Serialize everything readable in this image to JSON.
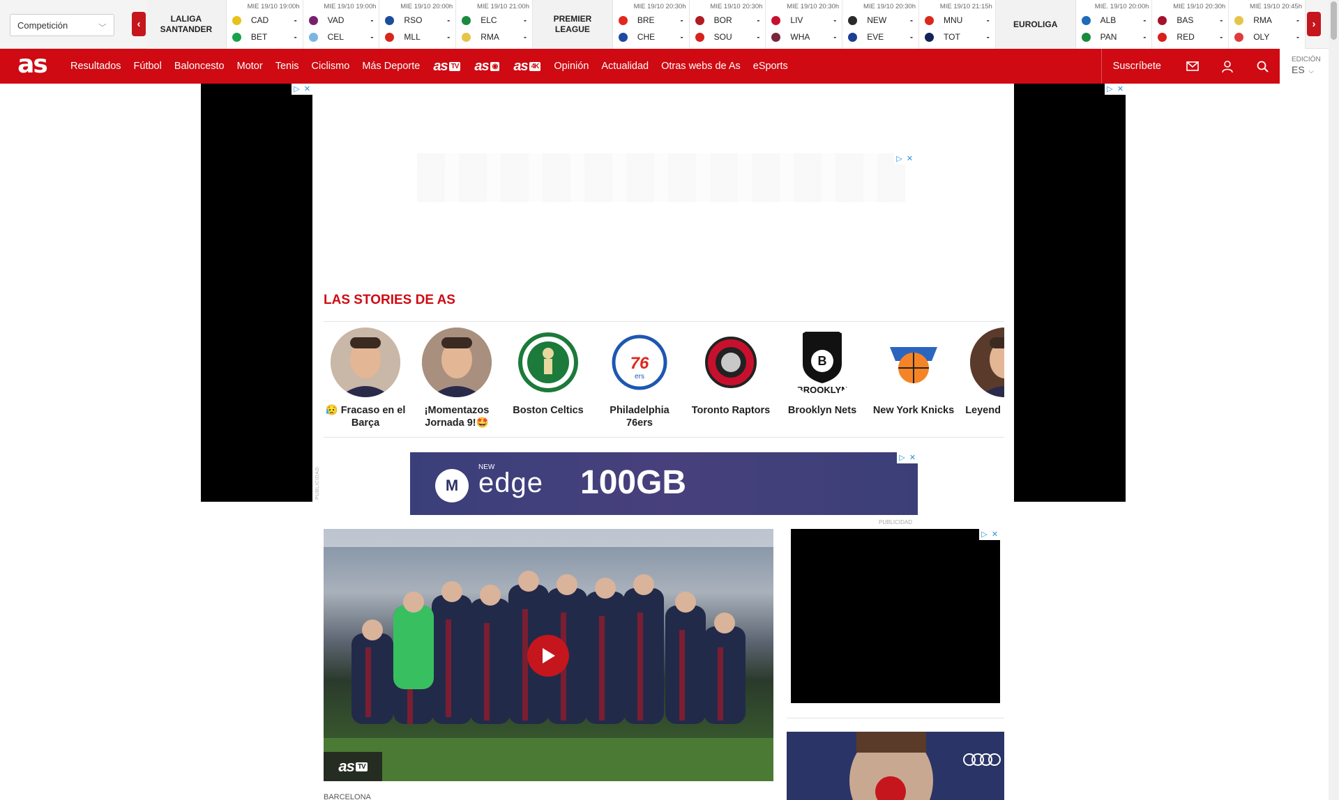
{
  "scores_bar": {
    "competition_select": "Competición",
    "leagues": [
      {
        "name": "LALIGA SANTANDER",
        "matches": [
          {
            "time": "MIE 19/10 19:00h",
            "home": "CAD",
            "away": "BET",
            "home_score": "-",
            "away_score": "-",
            "home_color": "#e8c21a",
            "away_color": "#1aa24a"
          },
          {
            "time": "MIE 19/10 19:00h",
            "home": "VAD",
            "away": "CEL",
            "home_score": "-",
            "away_score": "-",
            "home_color": "#7a1f6e",
            "away_color": "#7ab6e2"
          },
          {
            "time": "MIE 19/10 20:00h",
            "home": "RSO",
            "away": "MLL",
            "home_score": "-",
            "away_score": "-",
            "home_color": "#1b4d9a",
            "away_color": "#d8261c"
          },
          {
            "time": "MIE 19/10 21:00h",
            "home": "ELC",
            "away": "RMA",
            "home_score": "-",
            "away_score": "-",
            "home_color": "#1a8a3c",
            "away_color": "#e6c44a"
          }
        ]
      },
      {
        "name": "PREMIER LEAGUE",
        "matches": [
          {
            "time": "MIE 19/10 20:30h",
            "home": "BRE",
            "away": "CHE",
            "home_score": "-",
            "away_score": "-",
            "home_color": "#e0281e",
            "away_color": "#1d4aa0"
          },
          {
            "time": "MIE 19/10 20:30h",
            "home": "BOR",
            "away": "SOU",
            "home_score": "-",
            "away_score": "-",
            "home_color": "#b01c22",
            "away_color": "#d8201e"
          },
          {
            "time": "MIE 19/10 20:30h",
            "home": "LIV",
            "away": "WHA",
            "home_score": "-",
            "away_score": "-",
            "home_color": "#c8102e",
            "away_color": "#7a263a"
          },
          {
            "time": "MIE 19/10 20:30h",
            "home": "NEW",
            "away": "EVE",
            "home_score": "-",
            "away_score": "-",
            "home_color": "#2a2a2a",
            "away_color": "#1c3f94"
          },
          {
            "time": "MIE 19/10 21:15h",
            "home": "MNU",
            "away": "TOT",
            "home_score": "-",
            "away_score": "-",
            "home_color": "#da291c",
            "away_color": "#132257"
          }
        ]
      },
      {
        "name": "EUROLIGA",
        "matches": [
          {
            "time": "MIE. 19/10 20:00h",
            "home": "ALB",
            "away": "PAN",
            "home_score": "-",
            "away_score": "-",
            "home_color": "#1e6bb8",
            "away_color": "#1a8a3c"
          },
          {
            "time": "MIE 19/10 20:30h",
            "home": "BAS",
            "away": "RED",
            "home_score": "-",
            "away_score": "-",
            "home_color": "#a3122d",
            "away_color": "#d8201e"
          },
          {
            "time": "MIE 19/10 20:45h",
            "home": "RMA",
            "away": "OLY",
            "home_score": "-",
            "away_score": "-",
            "home_color": "#e6c44a",
            "away_color": "#e03a3a"
          }
        ]
      }
    ]
  },
  "nav": {
    "logo": "as",
    "items": [
      "Resultados",
      "Fútbol",
      "Baloncesto",
      "Motor",
      "Tenis",
      "Ciclismo",
      "Más Deporte"
    ],
    "brand_links": [
      {
        "text": "as",
        "badge": "TV"
      },
      {
        "text": "as",
        "badge": "◉"
      },
      {
        "text": "as",
        "badge": "4K"
      }
    ],
    "items_after": [
      "Opinión",
      "Actualidad",
      "Otras webs de As",
      "eSports"
    ],
    "subscribe": "Suscríbete",
    "edition_label": "EDICIÓN",
    "edition_code": "ES",
    "colors": {
      "brand_red": "#cf0a12"
    }
  },
  "ads": {
    "choice_icon": "▷",
    "close_icon": "✕",
    "publicidad": "PUBLICIDAD",
    "edge": {
      "new": "NEW",
      "brand": "edge",
      "gb": "100GB",
      "logo": "M"
    }
  },
  "stories": {
    "title": "LAS STORIES DE AS",
    "items": [
      {
        "label": "😥 Fracaso en el Barça",
        "icon": "person-avatar",
        "bg": "#c9b7a7"
      },
      {
        "label": "¡Momentazos Jornada 9!🤩",
        "icon": "person-avatar",
        "bg": "#a98f7e"
      },
      {
        "label": "Boston Celtics",
        "icon": "celtics-logo",
        "bg": "#ffffff"
      },
      {
        "label": "Philadelphia 76ers",
        "icon": "76ers-logo",
        "bg": "#ffffff"
      },
      {
        "label": "Toronto Raptors",
        "icon": "raptors-logo",
        "bg": "#ffffff"
      },
      {
        "label": "Brooklyn Nets",
        "icon": "nets-logo",
        "bg": "#ffffff"
      },
      {
        "label": "New York Knicks",
        "icon": "knicks-logo",
        "bg": "#ffffff"
      },
      {
        "label": "Leyend mate a L",
        "icon": "person-avatar",
        "bg": "#5a3b2b"
      }
    ]
  },
  "main_video": {
    "kicker": "BARCELONA",
    "badge": "as",
    "badge_suffix": "TV"
  }
}
